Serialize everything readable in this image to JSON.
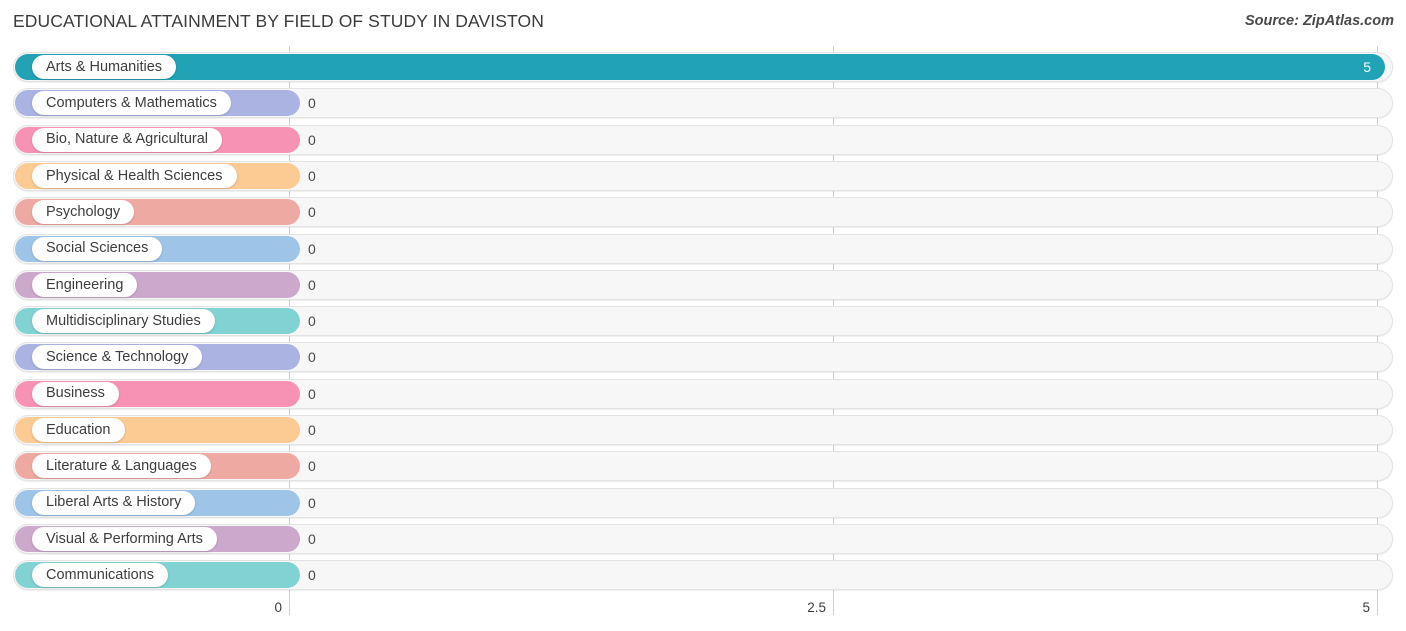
{
  "header": {
    "title": "EDUCATIONAL ATTAINMENT BY FIELD OF STUDY IN DAVISTON",
    "source": "Source: ZipAtlas.com"
  },
  "chart_data": {
    "type": "bar",
    "orientation": "horizontal",
    "title": "EDUCATIONAL ATTAINMENT BY FIELD OF STUDY IN DAVISTON",
    "xlabel": "",
    "ylabel": "",
    "xlim": [
      0,
      5
    ],
    "grid": true,
    "legend": "none",
    "xticks": [
      {
        "label": "0",
        "value": 0
      },
      {
        "label": "2.5",
        "value": 2.5
      },
      {
        "label": "5",
        "value": 5
      }
    ],
    "categories": [
      "Arts & Humanities",
      "Computers & Mathematics",
      "Bio, Nature & Agricultural",
      "Physical & Health Sciences",
      "Psychology",
      "Social Sciences",
      "Engineering",
      "Multidisciplinary Studies",
      "Science & Technology",
      "Business",
      "Education",
      "Literature & Languages",
      "Liberal Arts & History",
      "Visual & Performing Arts",
      "Communications"
    ],
    "values": [
      5,
      0,
      0,
      0,
      0,
      0,
      0,
      0,
      0,
      0,
      0,
      0,
      0,
      0,
      0
    ],
    "value_labels": [
      "5",
      "0",
      "0",
      "0",
      "0",
      "0",
      "0",
      "0",
      "0",
      "0",
      "0",
      "0",
      "0",
      "0",
      "0"
    ],
    "colors": [
      "#21a3b5",
      "#aab3e2",
      "#f892b5",
      "#fbcb93",
      "# efa9a3",
      "#9ec4e8",
      "#cda8cd",
      "#81d2d2",
      "#aab3e2",
      "#f892b5",
      "#fbcb93",
      "#efa9a3",
      "#9ec4e8",
      "#cda8cd",
      "#81d2d2"
    ]
  },
  "rows": [
    {
      "label": "Arts & Humanities",
      "value_label": "5",
      "color": "#21a3b5",
      "full": true
    },
    {
      "label": "Computers & Mathematics",
      "value_label": "0",
      "color": "#aab3e2",
      "full": false
    },
    {
      "label": "Bio, Nature & Agricultural",
      "value_label": "0",
      "color": "#f892b5",
      "full": false
    },
    {
      "label": "Physical & Health Sciences",
      "value_label": "0",
      "color": "#fbcb93",
      "full": false
    },
    {
      "label": "Psychology",
      "value_label": "0",
      "color": "#efa9a3",
      "full": false
    },
    {
      "label": "Social Sciences",
      "value_label": "0",
      "color": "#9ec4e8",
      "full": false
    },
    {
      "label": "Engineering",
      "value_label": "0",
      "color": "#cda8cd",
      "full": false
    },
    {
      "label": "Multidisciplinary Studies",
      "value_label": "0",
      "color": "#81d2d2",
      "full": false
    },
    {
      "label": "Science & Technology",
      "value_label": "0",
      "color": "#aab3e2",
      "full": false
    },
    {
      "label": "Business",
      "value_label": "0",
      "color": "#f892b5",
      "full": false
    },
    {
      "label": "Education",
      "value_label": "0",
      "color": "#fbcb93",
      "full": false
    },
    {
      "label": "Literature & Languages",
      "value_label": "0",
      "color": "#efa9a3",
      "full": false
    },
    {
      "label": "Liberal Arts & History",
      "value_label": "0",
      "color": "#9ec4e8",
      "full": false
    },
    {
      "label": "Visual & Performing Arts",
      "value_label": "0",
      "color": "#cda8cd",
      "full": false
    },
    {
      "label": "Communications",
      "value_label": "0",
      "color": "#81d2d2",
      "full": false
    }
  ]
}
